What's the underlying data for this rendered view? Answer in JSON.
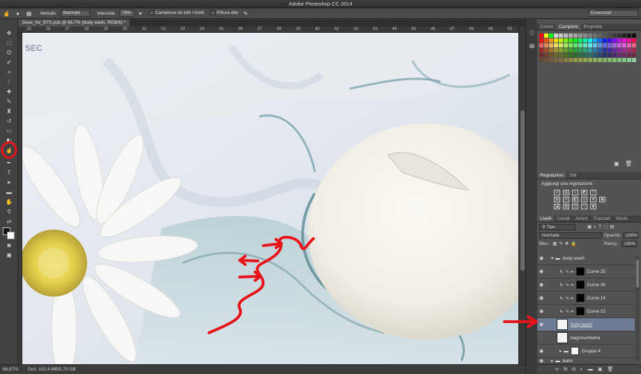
{
  "window": {
    "title": "Adobe Photoshop CC 2014"
  },
  "options_bar": {
    "metodo_label": "Metodo:",
    "metodo_value": "Normale",
    "intensita_label": "Intensità:",
    "intensita_value": "79%",
    "campiona_label": "Campiona da tutti i livelli",
    "pittura_label": "Pittura dito",
    "workspace": "Essenziali"
  },
  "document": {
    "tab_title": "Dove_for_BTS.psb @ 66,7% (body wash, RGB/8) *",
    "ruler_ticks": [
      "25",
      "26",
      "27",
      "28",
      "29",
      "30",
      "31",
      "32",
      "33",
      "34",
      "35",
      "36",
      "37",
      "38",
      "39",
      "40",
      "41",
      "42",
      "43",
      "44",
      "45",
      "46",
      "47",
      "48",
      "49",
      "50"
    ],
    "canvas_text": "SEC"
  },
  "status_bar": {
    "zoom": "66,67%",
    "doc_info": "Doc: 102,4 MB/5,70 GB"
  },
  "swatches_panel": {
    "tabs": [
      "Colore",
      "Campioni",
      "Proprietà"
    ],
    "active_tab": "Campioni"
  },
  "adjustments_panel": {
    "tabs": [
      "Regolazioni",
      "Stili"
    ],
    "active_tab": "Regolazioni",
    "title": "Aggiungi una regolazione"
  },
  "layers_panel": {
    "tabs": [
      "Livelli",
      "Canali",
      "Azioni",
      "Tracciati",
      "Storia"
    ],
    "active_tab": "Livelli",
    "filter": "Tipo",
    "blend_mode": "Normale",
    "opacity_label": "Opacità:",
    "opacity_value": "100%",
    "lock_label": "Bloc.:",
    "fill_label": "Riemp.:",
    "fill_value": "100%",
    "layers": [
      {
        "name": "body wash",
        "kind": "group"
      },
      {
        "name": "Curve 25",
        "kind": "adjustment"
      },
      {
        "name": "Curve 26",
        "kind": "adjustment"
      },
      {
        "name": "Curve 14",
        "kind": "adjustment"
      },
      {
        "name": "Curve 15",
        "kind": "adjustment"
      },
      {
        "name": "body wash",
        "kind": "pixel",
        "selected": true
      },
      {
        "name": "bagnoschiuma",
        "kind": "pixel"
      },
      {
        "name": "Gruppo 4",
        "kind": "group"
      },
      {
        "name": "balm",
        "kind": "group"
      }
    ]
  },
  "colors": {
    "annotation": "#e8141a",
    "selected_layer": "#6d7c93",
    "panel_bg": "#535353"
  }
}
